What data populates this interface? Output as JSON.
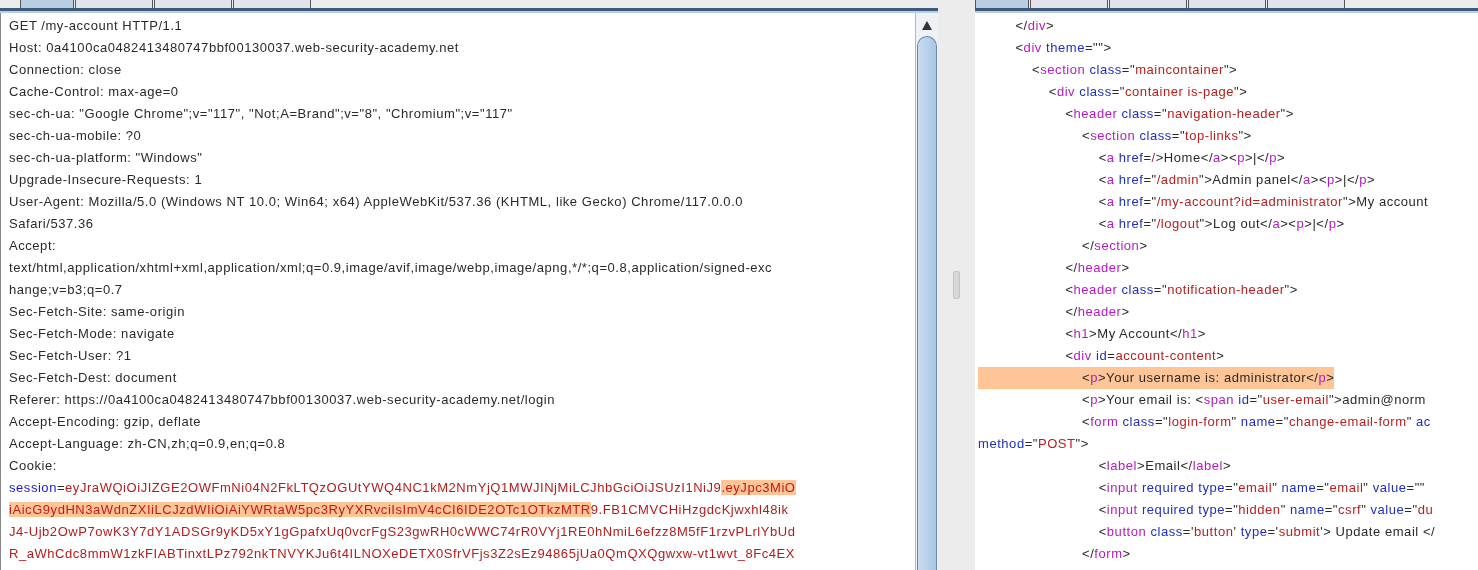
{
  "request_pane": {
    "tabs": [
      {
        "selected": true
      },
      {
        "selected": false
      },
      {
        "selected": false
      },
      {
        "selected": false
      }
    ],
    "lines": [
      {
        "segments": [
          {
            "kind": "plain",
            "text": "GET /my-account HTTP/1.1"
          }
        ]
      },
      {
        "segments": [
          {
            "kind": "plain",
            "text": "Host: 0a4100ca0482413480747bbf00130037.web-security-academy.net"
          }
        ]
      },
      {
        "segments": [
          {
            "kind": "plain",
            "text": "Connection: close"
          }
        ]
      },
      {
        "segments": [
          {
            "kind": "plain",
            "text": "Cache-Control: max-age=0"
          }
        ]
      },
      {
        "segments": [
          {
            "kind": "plain",
            "text": "sec-ch-ua: \"Google Chrome\";v=\"117\", \"Not;A=Brand\";v=\"8\", \"Chromium\";v=\"117\""
          }
        ]
      },
      {
        "segments": [
          {
            "kind": "plain",
            "text": "sec-ch-ua-mobile: ?0"
          }
        ]
      },
      {
        "segments": [
          {
            "kind": "plain",
            "text": "sec-ch-ua-platform: \"Windows\""
          }
        ]
      },
      {
        "segments": [
          {
            "kind": "plain",
            "text": "Upgrade-Insecure-Requests: 1"
          }
        ]
      },
      {
        "segments": [
          {
            "kind": "plain",
            "text": "User-Agent: Mozilla/5.0 (Windows NT 10.0; Win64; x64) AppleWebKit/537.36 (KHTML, like Gecko) Chrome/117.0.0.0"
          }
        ]
      },
      {
        "segments": [
          {
            "kind": "plain",
            "text": "Safari/537.36"
          }
        ]
      },
      {
        "segments": [
          {
            "kind": "plain",
            "text": "Accept:"
          }
        ]
      },
      {
        "segments": [
          {
            "kind": "plain",
            "text": "text/html,application/xhtml+xml,application/xml;q=0.9,image/avif,image/webp,image/apng,*/*;q=0.8,application/signed-exc"
          }
        ]
      },
      {
        "segments": [
          {
            "kind": "plain",
            "text": "hange;v=b3;q=0.7"
          }
        ]
      },
      {
        "segments": [
          {
            "kind": "plain",
            "text": "Sec-Fetch-Site: same-origin"
          }
        ]
      },
      {
        "segments": [
          {
            "kind": "plain",
            "text": "Sec-Fetch-Mode: navigate"
          }
        ]
      },
      {
        "segments": [
          {
            "kind": "plain",
            "text": "Sec-Fetch-User: ?1"
          }
        ]
      },
      {
        "segments": [
          {
            "kind": "plain",
            "text": "Sec-Fetch-Dest: document"
          }
        ]
      },
      {
        "segments": [
          {
            "kind": "plain",
            "text": "Referer: https://0a4100ca0482413480747bbf00130037.web-security-academy.net/login"
          }
        ]
      },
      {
        "segments": [
          {
            "kind": "plain",
            "text": "Accept-Encoding: gzip, deflate"
          }
        ]
      },
      {
        "segments": [
          {
            "kind": "plain",
            "text": "Accept-Language: zh-CN,zh;q=0.9,en;q=0.8"
          }
        ]
      },
      {
        "segments": [
          {
            "kind": "plain",
            "text": "Cookie:"
          }
        ]
      },
      {
        "segments": [
          {
            "kind": "key",
            "text": "session"
          },
          {
            "kind": "plain",
            "text": "="
          },
          {
            "kind": "value",
            "text": "eyJraWQiOiJIZGE2OWFmNi04N2FkLTQzOGUtYWQ4NC1kM2NmYjQ1MWJINjMiLCJhbGciOiJSUzI1NiJ9"
          },
          {
            "kind": "match",
            "text": ".eyJpc3MiO"
          }
        ]
      },
      {
        "segments": [
          {
            "kind": "match",
            "text": "iAicG9ydHN3aWdnZXIiLCJzdWIiOiAiYWRtaW5pc3RyYXRvciIsImV4cCI6IDE2OTc1OTkzMTR"
          },
          {
            "kind": "value",
            "text": "9.FB1CMVCHiHzgdcKjwxhl48ik"
          }
        ]
      },
      {
        "segments": [
          {
            "kind": "value",
            "text": "J4-Ujb2OwP7owK3Y7dY1ADSGr9yKD5xY1gGpafxUq0vcrFgS23gwRH0cWWC74rR0VYj1RE0hNmiL6efzz8M5fF1rzvPLrlYbUd"
          }
        ]
      },
      {
        "segments": [
          {
            "kind": "value",
            "text": "R_aWhCdc8mmW1zkFIABTinxtLPz792nkTNVYKJu6t4ILNOXeDETX0SfrVFjs3Z2sEz94865jUa0QmQXQgwxw-vt1wvt_8Fc4EX"
          }
        ]
      }
    ]
  },
  "response_pane": {
    "tabs": [
      {
        "selected": true
      },
      {
        "selected": false
      },
      {
        "selected": false
      },
      {
        "selected": false
      },
      {
        "selected": false
      }
    ],
    "lines": [
      {
        "highlighted": false,
        "tokens": [
          {
            "kind": "punct",
            "text": "         </"
          },
          {
            "kind": "tag",
            "text": "div"
          },
          {
            "kind": "punct",
            "text": ">"
          }
        ]
      },
      {
        "highlighted": false,
        "tokens": [
          {
            "kind": "punct",
            "text": "         <"
          },
          {
            "kind": "tag",
            "text": "div"
          },
          {
            "kind": "attr",
            "text": " theme"
          },
          {
            "kind": "punct",
            "text": "=\"\">"
          }
        ]
      },
      {
        "highlighted": false,
        "tokens": [
          {
            "kind": "punct",
            "text": "             <"
          },
          {
            "kind": "tag",
            "text": "section"
          },
          {
            "kind": "attr",
            "text": " class"
          },
          {
            "kind": "punct",
            "text": "=\""
          },
          {
            "kind": "value",
            "text": "maincontainer"
          },
          {
            "kind": "punct",
            "text": "\">"
          }
        ]
      },
      {
        "highlighted": false,
        "tokens": [
          {
            "kind": "punct",
            "text": "                 <"
          },
          {
            "kind": "tag",
            "text": "div"
          },
          {
            "kind": "attr",
            "text": " class"
          },
          {
            "kind": "punct",
            "text": "=\""
          },
          {
            "kind": "value",
            "text": "container is-page"
          },
          {
            "kind": "punct",
            "text": "\">"
          }
        ]
      },
      {
        "highlighted": false,
        "tokens": [
          {
            "kind": "punct",
            "text": "                     <"
          },
          {
            "kind": "tag",
            "text": "header"
          },
          {
            "kind": "attr",
            "text": " class"
          },
          {
            "kind": "punct",
            "text": "=\""
          },
          {
            "kind": "value",
            "text": "navigation-header"
          },
          {
            "kind": "punct",
            "text": "\">"
          }
        ]
      },
      {
        "highlighted": false,
        "tokens": [
          {
            "kind": "punct",
            "text": "                         <"
          },
          {
            "kind": "tag",
            "text": "section"
          },
          {
            "kind": "attr",
            "text": " class"
          },
          {
            "kind": "punct",
            "text": "=\""
          },
          {
            "kind": "value",
            "text": "top-links"
          },
          {
            "kind": "punct",
            "text": "\">"
          }
        ]
      },
      {
        "highlighted": false,
        "tokens": [
          {
            "kind": "punct",
            "text": "                             <"
          },
          {
            "kind": "tag",
            "text": "a"
          },
          {
            "kind": "attr",
            "text": " href"
          },
          {
            "kind": "punct",
            "text": "="
          },
          {
            "kind": "value",
            "text": "/"
          },
          {
            "kind": "punct",
            "text": ">Home</"
          },
          {
            "kind": "tag",
            "text": "a"
          },
          {
            "kind": "punct",
            "text": "><"
          },
          {
            "kind": "tag",
            "text": "p"
          },
          {
            "kind": "punct",
            "text": ">|</"
          },
          {
            "kind": "tag",
            "text": "p"
          },
          {
            "kind": "punct",
            "text": ">"
          }
        ]
      },
      {
        "highlighted": false,
        "tokens": [
          {
            "kind": "punct",
            "text": "                             <"
          },
          {
            "kind": "tag",
            "text": "a"
          },
          {
            "kind": "attr",
            "text": " href"
          },
          {
            "kind": "punct",
            "text": "=\""
          },
          {
            "kind": "value",
            "text": "/admin"
          },
          {
            "kind": "punct",
            "text": "\">Admin panel</"
          },
          {
            "kind": "tag",
            "text": "a"
          },
          {
            "kind": "punct",
            "text": "><"
          },
          {
            "kind": "tag",
            "text": "p"
          },
          {
            "kind": "punct",
            "text": ">|</"
          },
          {
            "kind": "tag",
            "text": "p"
          },
          {
            "kind": "punct",
            "text": ">"
          }
        ]
      },
      {
        "highlighted": false,
        "tokens": [
          {
            "kind": "punct",
            "text": "                             <"
          },
          {
            "kind": "tag",
            "text": "a"
          },
          {
            "kind": "attr",
            "text": " href"
          },
          {
            "kind": "punct",
            "text": "=\""
          },
          {
            "kind": "value",
            "text": "/my-account?id=administrator"
          },
          {
            "kind": "punct",
            "text": "\">My account"
          }
        ]
      },
      {
        "highlighted": false,
        "tokens": [
          {
            "kind": "punct",
            "text": "                             <"
          },
          {
            "kind": "tag",
            "text": "a"
          },
          {
            "kind": "attr",
            "text": " href"
          },
          {
            "kind": "punct",
            "text": "=\""
          },
          {
            "kind": "value",
            "text": "/logout"
          },
          {
            "kind": "punct",
            "text": "\">Log out</"
          },
          {
            "kind": "tag",
            "text": "a"
          },
          {
            "kind": "punct",
            "text": "><"
          },
          {
            "kind": "tag",
            "text": "p"
          },
          {
            "kind": "punct",
            "text": ">|</"
          },
          {
            "kind": "tag",
            "text": "p"
          },
          {
            "kind": "punct",
            "text": ">"
          }
        ]
      },
      {
        "highlighted": false,
        "tokens": [
          {
            "kind": "punct",
            "text": "                         </"
          },
          {
            "kind": "tag",
            "text": "section"
          },
          {
            "kind": "punct",
            "text": ">"
          }
        ]
      },
      {
        "highlighted": false,
        "tokens": [
          {
            "kind": "punct",
            "text": "                     </"
          },
          {
            "kind": "tag",
            "text": "header"
          },
          {
            "kind": "punct",
            "text": ">"
          }
        ]
      },
      {
        "highlighted": false,
        "tokens": [
          {
            "kind": "punct",
            "text": "                     <"
          },
          {
            "kind": "tag",
            "text": "header"
          },
          {
            "kind": "attr",
            "text": " class"
          },
          {
            "kind": "punct",
            "text": "=\""
          },
          {
            "kind": "value",
            "text": "notification-header"
          },
          {
            "kind": "punct",
            "text": "\">"
          }
        ]
      },
      {
        "highlighted": false,
        "tokens": [
          {
            "kind": "punct",
            "text": "                     </"
          },
          {
            "kind": "tag",
            "text": "header"
          },
          {
            "kind": "punct",
            "text": ">"
          }
        ]
      },
      {
        "highlighted": false,
        "tokens": [
          {
            "kind": "punct",
            "text": "                     <"
          },
          {
            "kind": "tag",
            "text": "h1"
          },
          {
            "kind": "punct",
            "text": ">My Account</"
          },
          {
            "kind": "tag",
            "text": "h1"
          },
          {
            "kind": "punct",
            "text": ">"
          }
        ]
      },
      {
        "highlighted": false,
        "tokens": [
          {
            "kind": "punct",
            "text": "                     <"
          },
          {
            "kind": "tag",
            "text": "div"
          },
          {
            "kind": "attr",
            "text": " id"
          },
          {
            "kind": "punct",
            "text": "="
          },
          {
            "kind": "value",
            "text": "account-content"
          },
          {
            "kind": "punct",
            "text": ">"
          }
        ]
      },
      {
        "highlighted": true,
        "tokens": [
          {
            "kind": "punct",
            "text": "                         <"
          },
          {
            "kind": "tag",
            "text": "p"
          },
          {
            "kind": "punct",
            "text": ">Your username is: administrator</"
          },
          {
            "kind": "tag",
            "text": "p"
          },
          {
            "kind": "punct",
            "text": ">"
          }
        ]
      },
      {
        "highlighted": false,
        "tokens": [
          {
            "kind": "punct",
            "text": "                         <"
          },
          {
            "kind": "tag",
            "text": "p"
          },
          {
            "kind": "punct",
            "text": ">Your email is: <"
          },
          {
            "kind": "tag",
            "text": "span"
          },
          {
            "kind": "attr",
            "text": " id"
          },
          {
            "kind": "punct",
            "text": "=\""
          },
          {
            "kind": "value",
            "text": "user-email"
          },
          {
            "kind": "punct",
            "text": "\">admin@norm"
          }
        ]
      },
      {
        "highlighted": false,
        "tokens": [
          {
            "kind": "punct",
            "text": "                         <"
          },
          {
            "kind": "tag",
            "text": "form"
          },
          {
            "kind": "attr",
            "text": " class"
          },
          {
            "kind": "punct",
            "text": "=\""
          },
          {
            "kind": "value",
            "text": "login-form"
          },
          {
            "kind": "punct",
            "text": "\""
          },
          {
            "kind": "attr",
            "text": " name"
          },
          {
            "kind": "punct",
            "text": "=\""
          },
          {
            "kind": "value",
            "text": "change-email-form"
          },
          {
            "kind": "punct",
            "text": "\""
          },
          {
            "kind": "attr",
            "text": " ac"
          }
        ]
      },
      {
        "highlighted": false,
        "tokens": [
          {
            "kind": "attr",
            "text": "method"
          },
          {
            "kind": "punct",
            "text": "=\""
          },
          {
            "kind": "value",
            "text": "POST"
          },
          {
            "kind": "punct",
            "text": "\">"
          }
        ]
      },
      {
        "highlighted": false,
        "tokens": [
          {
            "kind": "punct",
            "text": "                             <"
          },
          {
            "kind": "tag",
            "text": "label"
          },
          {
            "kind": "punct",
            "text": ">Email</"
          },
          {
            "kind": "tag",
            "text": "label"
          },
          {
            "kind": "punct",
            "text": ">"
          }
        ]
      },
      {
        "highlighted": false,
        "tokens": [
          {
            "kind": "punct",
            "text": "                             <"
          },
          {
            "kind": "tag",
            "text": "input"
          },
          {
            "kind": "attr",
            "text": " required type"
          },
          {
            "kind": "punct",
            "text": "=\""
          },
          {
            "kind": "value",
            "text": "email"
          },
          {
            "kind": "punct",
            "text": "\""
          },
          {
            "kind": "attr",
            "text": " name"
          },
          {
            "kind": "punct",
            "text": "=\""
          },
          {
            "kind": "value",
            "text": "email"
          },
          {
            "kind": "punct",
            "text": "\""
          },
          {
            "kind": "attr",
            "text": " value"
          },
          {
            "kind": "punct",
            "text": "=\"\""
          }
        ]
      },
      {
        "highlighted": false,
        "tokens": [
          {
            "kind": "punct",
            "text": "                             <"
          },
          {
            "kind": "tag",
            "text": "input"
          },
          {
            "kind": "attr",
            "text": " required type"
          },
          {
            "kind": "punct",
            "text": "=\""
          },
          {
            "kind": "value",
            "text": "hidden"
          },
          {
            "kind": "punct",
            "text": "\""
          },
          {
            "kind": "attr",
            "text": " name"
          },
          {
            "kind": "punct",
            "text": "=\""
          },
          {
            "kind": "value",
            "text": "csrf"
          },
          {
            "kind": "punct",
            "text": "\""
          },
          {
            "kind": "attr",
            "text": " value"
          },
          {
            "kind": "punct",
            "text": "=\""
          },
          {
            "kind": "value",
            "text": "du"
          }
        ]
      },
      {
        "highlighted": false,
        "tokens": [
          {
            "kind": "punct",
            "text": "                             <"
          },
          {
            "kind": "tag",
            "text": "button"
          },
          {
            "kind": "attr",
            "text": " class"
          },
          {
            "kind": "punct",
            "text": "='"
          },
          {
            "kind": "value",
            "text": "button"
          },
          {
            "kind": "punct",
            "text": "'"
          },
          {
            "kind": "attr",
            "text": " type"
          },
          {
            "kind": "punct",
            "text": "='"
          },
          {
            "kind": "value",
            "text": "submit"
          },
          {
            "kind": "punct",
            "text": "'> Update email </"
          }
        ]
      },
      {
        "highlighted": false,
        "tokens": [
          {
            "kind": "punct",
            "text": "                         </"
          },
          {
            "kind": "tag",
            "text": "form"
          },
          {
            "kind": "punct",
            "text": ">"
          }
        ]
      }
    ]
  }
}
